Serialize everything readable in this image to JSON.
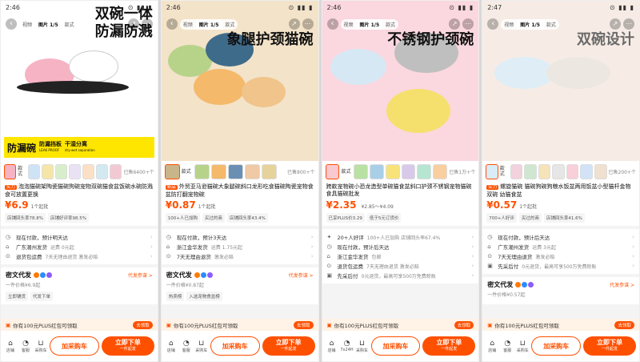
{
  "panels": [
    {
      "status": {
        "time": "2:46",
        "icons": "⊙ ▮▮ ▮"
      },
      "tabs": [
        "视频",
        "图片 1/5",
        "款式"
      ],
      "headline": [
        "双碗一体",
        "防漏防溅"
      ],
      "hero_bg": "#ffffff",
      "features": {
        "big": "防漏碗",
        "f1": "防漏挡板",
        "f1s": "LEAK PROOF",
        "f2": "干湿分离",
        "f2s": "dry-wet separation"
      },
      "swatches": [
        "#f6b3c4",
        "#cfe3f6",
        "#f5e6a8",
        "#d8eecb",
        "#e9e2f4",
        "#fce0c6",
        "#d3e9f2",
        "#f2c9d3"
      ],
      "kuanshi": "款式",
      "swatch_text": "已售6400+个",
      "title_tag": "实力",
      "title": "泡泡猫碗架陶瓷猫碗狗碗宠物双碗猫食盆饭碗水碗防溅食可放置更换",
      "price": "¥6.9",
      "moq": "1个起批",
      "sold": "",
      "chips": [
        "店铺回头率78.8%",
        "店铺好评率98.5%"
      ],
      "lines": [
        {
          "icon": "◷",
          "text": "现在付款，预计明天达",
          "sub": ""
        },
        {
          "icon": "⌂",
          "text": "广东潮州发货",
          "sub": "运费 0元起"
        },
        {
          "icon": "⊙",
          "text": "退货包运费",
          "sub": "7天无理由退货  激发必赔"
        }
      ],
      "seller": "密文代发",
      "seller_sub": "一件价格¥6.9起",
      "seller_enter": "代发参谋 >",
      "seller_tags": [
        "立即铺货",
        "代发下单"
      ],
      "promo_text": "你有100元PLUS红包可领取",
      "promo_amt": "100元",
      "promo_btn": "去领取",
      "bottom": {
        "b1": "店铺",
        "b2": "客服",
        "b3": "采购车",
        "cart": "加采购车",
        "buy": "立即下单",
        "buy_sub": "一件起发"
      }
    },
    {
      "status": {
        "time": "2:46",
        "icons": "⊙ ▮▮ ▮"
      },
      "tabs": [
        "视频",
        "图片 1/5",
        "款式"
      ],
      "headline": [
        "象腿护颈猫碗"
      ],
      "hero_bg": "#f3e3c9",
      "features": null,
      "swatches": [
        "#c9b58a",
        "#b7d38a",
        "#f4b96b",
        "#6b8fb3",
        "#f0c9a6",
        "#e6d39b"
      ],
      "kuanshi": "款式",
      "swatch_text": "已售800+个",
      "title_tag": "新品",
      "title": "外贸亚马逊猫碗大象腿碗斜口龙形吃食猫碗陶瓷宠物食盆防打翻宠物碗",
      "price": "¥0.87",
      "moq": "1个起批",
      "sold": "",
      "chips": [
        "100+人已加购",
        "买过的商",
        "店铺回头率43.4%"
      ],
      "lines": [
        {
          "icon": "◷",
          "text": "现在付款，预计3天达",
          "sub": ""
        },
        {
          "icon": "⌂",
          "text": "浙江金华发货",
          "sub": "运费 1.75元起"
        },
        {
          "icon": "⊙",
          "text": "7天无理由退货",
          "sub": "激发必赔"
        }
      ],
      "seller": "密文代发",
      "seller_sub": "一件价格¥0.87起",
      "seller_enter": "代发参谋 >",
      "seller_tags": [
        "热卖榜",
        "入选宠物食盆榜"
      ],
      "promo_text": "你有100元PLUS红包可领取",
      "promo_amt": "100元",
      "promo_btn": "去领取",
      "bottom": {
        "b1": "店铺",
        "b2": "客服",
        "b3": "采购车",
        "cart": "加采购车",
        "buy": "立即下单",
        "buy_sub": "一件起发"
      }
    },
    {
      "status": {
        "time": "2:46",
        "icons": "⊙ ▮▮ ▮"
      },
      "tabs": [
        "视频",
        "图片 1/5",
        "款式"
      ],
      "headline": [
        "不锈钢护颈碗"
      ],
      "hero_bg": "#fbd7df",
      "features": null,
      "swatches": [
        "#f9c8d1",
        "#b9e1a4",
        "#a9cfe8",
        "#f7e37a",
        "#d8c9ea",
        "#b6e6d2",
        "#f9cfa0"
      ],
      "kuanshi": "款式",
      "swatch_text": "已售1万+个",
      "title_tag": "",
      "title": "跨款宠物碗小恐龙造型单碗猫食盆斜口护颈不锈钢宠物猫碗食具猫碗批发",
      "price": "¥2.35",
      "moq": "",
      "sold": "¥2.85～¥4.09",
      "chips": [
        "已享PLUS价3.29",
        "低于5元订货价"
      ],
      "lines": [
        {
          "icon": "✦",
          "text": "20+人好评",
          "sub": "100+人已加购  店铺回头率67.4%"
        },
        {
          "icon": "◷",
          "text": "现在付款，预计后天达",
          "sub": ""
        },
        {
          "icon": "⌂",
          "text": "浙江金华发货",
          "sub": "包邮"
        },
        {
          "icon": "⊙",
          "text": "退货包运费",
          "sub": "7天无理由退货  激发必赔"
        },
        {
          "icon": "▣",
          "text": "先采后付",
          "sub": "0元退货，最高可享500万免费赊账"
        }
      ],
      "seller": "",
      "seller_sub": "",
      "seller_enter": "",
      "seller_tags": [],
      "promo_text": "你有100元PLUS红包可领取",
      "promo_amt": "100元",
      "promo_btn": "去领取",
      "bottom": {
        "b1": "店铺",
        "b2": "7x24H",
        "b3": "采购车",
        "cart": "加采购车",
        "buy": "立即下单",
        "buy_sub": "一件起发"
      }
    },
    {
      "status": {
        "time": "2:47",
        "icons": "⊙ ▮▮ ▮"
      },
      "tabs": [
        "视频",
        "图片 1/5",
        "款式"
      ],
      "headline": [
        "双碗设计"
      ],
      "hero_bg": "#f6ece5",
      "features": null,
      "swatches": [
        "#d9ecf7",
        "#f2d2dc",
        "#cfe7d0",
        "#f6e3b9",
        "#e6e6e6",
        "#f9cfd9",
        "#d2e3f7",
        "#efe0cf"
      ],
      "kuanshi": "款式",
      "swatch_text": "已售200+个",
      "title_tag": "实力",
      "title": "螺旋猫碗 猫碗狗碗狗粮水饭盆两用饭盆小型猫杆金物双碗 幼猫食盆",
      "price": "¥0.57",
      "moq": "1个起批",
      "sold": "",
      "chips": [
        "700+人好评",
        "买过的商",
        "店铺回头率41.6%"
      ],
      "lines": [
        {
          "icon": "◷",
          "text": "现在付款，预计后天达",
          "sub": ""
        },
        {
          "icon": "⌂",
          "text": "广东潮州发货",
          "sub": "运费 3元起"
        },
        {
          "icon": "⊙",
          "text": "7天无理由退货",
          "sub": "激发必赔"
        },
        {
          "icon": "▣",
          "text": "先采后付",
          "sub": "0元退货，最高可享500万免费赊账"
        }
      ],
      "seller": "密文代发",
      "seller_sub": "一件价格¥0.57起",
      "seller_enter": "代发参谋 >",
      "seller_tags": [],
      "promo_text": "你有100元PLUS红包可领取",
      "promo_amt": "100元",
      "promo_btn": "去领取",
      "bottom": {
        "b1": "店铺",
        "b2": "客服",
        "b3": "采购车",
        "cart": "加采购车",
        "buy": "立即下单",
        "buy_sub": "一件起发"
      }
    }
  ],
  "colors": {
    "accent": "#ff5000",
    "promo_bg": "#fff2e6"
  }
}
